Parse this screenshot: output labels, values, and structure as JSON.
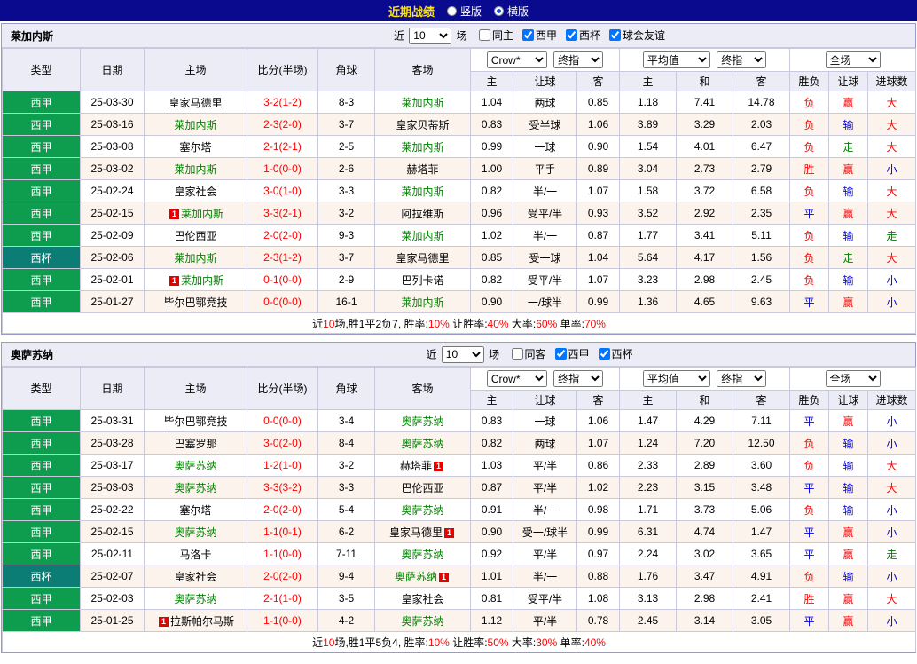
{
  "topbar": {
    "title": "近期战绩",
    "radio_vertical": "竖版",
    "radio_horizontal": "横版",
    "selected": "横版"
  },
  "columns": {
    "type": "类型",
    "date": "日期",
    "home": "主场",
    "score": "比分(半场)",
    "corner": "角球",
    "away": "客场",
    "odds_home": "主",
    "odds_handicap": "让球",
    "odds_away": "客",
    "avg_home": "主",
    "avg_draw": "和",
    "avg_away": "客",
    "result": "胜负",
    "handicap_result": "让球",
    "goals": "进球数"
  },
  "filters": {
    "near_label": "近",
    "count_value": "10",
    "match_label": "场",
    "dropdown_crow": "Crow*",
    "dropdown_final1": "终指",
    "dropdown_avg": "平均值",
    "dropdown_final2": "终指",
    "dropdown_fulltime": "全场"
  },
  "colors": {
    "topbar_bg": "#0a0a8f",
    "title_yellow": "#ffe400",
    "liga_green": "#0e9d4e",
    "cup_teal": "#0c7d74",
    "focus_team_green": "#008000",
    "score_red": "#ff0000",
    "win_red": "#ff0000",
    "lose_blue": "#0000e6",
    "push_green": "#008000",
    "header_lavender": "#ececf6",
    "alt_row_pink": "#fcf3ec"
  },
  "sections": [
    {
      "team": "莱加内斯",
      "checkboxes": [
        {
          "label": "同主",
          "checked": false
        },
        {
          "label": "西甲",
          "checked": true
        },
        {
          "label": "西杯",
          "checked": true
        },
        {
          "label": "球会友谊",
          "checked": true
        }
      ],
      "rows": [
        {
          "league": "西甲",
          "league_style": "liga",
          "date": "25-03-30",
          "home": {
            "name": "皇家马德里",
            "focus": false,
            "badge": ""
          },
          "score": "3-2(1-2)",
          "corners": "8-3",
          "away": {
            "name": "莱加内斯",
            "focus": true,
            "badge": ""
          },
          "odds": [
            "1.04",
            "两球",
            "0.85"
          ],
          "avg": [
            "1.18",
            "7.41",
            "14.78"
          ],
          "result": {
            "t": "负",
            "c": "r"
          },
          "handicap": {
            "t": "赢",
            "c": "r"
          },
          "goals": {
            "t": "大",
            "c": "r"
          }
        },
        {
          "league": "西甲",
          "league_style": "liga",
          "date": "25-03-16",
          "home": {
            "name": "莱加内斯",
            "focus": true,
            "badge": ""
          },
          "score": "2-3(2-0)",
          "corners": "3-7",
          "away": {
            "name": "皇家贝蒂斯",
            "focus": false,
            "badge": ""
          },
          "odds": [
            "0.83",
            "受半球",
            "1.06"
          ],
          "avg": [
            "3.89",
            "3.29",
            "2.03"
          ],
          "result": {
            "t": "负",
            "c": "r"
          },
          "handicap": {
            "t": "输",
            "c": "b"
          },
          "goals": {
            "t": "大",
            "c": "r"
          }
        },
        {
          "league": "西甲",
          "league_style": "liga",
          "date": "25-03-08",
          "home": {
            "name": "塞尔塔",
            "focus": false,
            "badge": ""
          },
          "score": "2-1(2-1)",
          "corners": "2-5",
          "away": {
            "name": "莱加内斯",
            "focus": true,
            "badge": ""
          },
          "odds": [
            "0.99",
            "一球",
            "0.90"
          ],
          "avg": [
            "1.54",
            "4.01",
            "6.47"
          ],
          "result": {
            "t": "负",
            "c": "r"
          },
          "handicap": {
            "t": "走",
            "c": "g"
          },
          "goals": {
            "t": "大",
            "c": "r"
          }
        },
        {
          "league": "西甲",
          "league_style": "liga",
          "date": "25-03-02",
          "home": {
            "name": "莱加内斯",
            "focus": true,
            "badge": ""
          },
          "score": "1-0(0-0)",
          "corners": "2-6",
          "away": {
            "name": "赫塔菲",
            "focus": false,
            "badge": ""
          },
          "odds": [
            "1.00",
            "平手",
            "0.89"
          ],
          "avg": [
            "3.04",
            "2.73",
            "2.79"
          ],
          "result": {
            "t": "胜",
            "c": "r"
          },
          "handicap": {
            "t": "赢",
            "c": "r"
          },
          "goals": {
            "t": "小",
            "c": "b"
          }
        },
        {
          "league": "西甲",
          "league_style": "liga",
          "date": "25-02-24",
          "home": {
            "name": "皇家社会",
            "focus": false,
            "badge": ""
          },
          "score": "3-0(1-0)",
          "corners": "3-3",
          "away": {
            "name": "莱加内斯",
            "focus": true,
            "badge": ""
          },
          "odds": [
            "0.82",
            "半/一",
            "1.07"
          ],
          "avg": [
            "1.58",
            "3.72",
            "6.58"
          ],
          "result": {
            "t": "负",
            "c": "r"
          },
          "handicap": {
            "t": "输",
            "c": "b"
          },
          "goals": {
            "t": "大",
            "c": "r"
          }
        },
        {
          "league": "西甲",
          "league_style": "liga",
          "date": "25-02-15",
          "home": {
            "name": "莱加内斯",
            "focus": true,
            "badge": "before"
          },
          "score": "3-3(2-1)",
          "corners": "3-2",
          "away": {
            "name": "阿拉维斯",
            "focus": false,
            "badge": ""
          },
          "odds": [
            "0.96",
            "受平/半",
            "0.93"
          ],
          "avg": [
            "3.52",
            "2.92",
            "2.35"
          ],
          "result": {
            "t": "平",
            "c": "b"
          },
          "handicap": {
            "t": "赢",
            "c": "r"
          },
          "goals": {
            "t": "大",
            "c": "r"
          }
        },
        {
          "league": "西甲",
          "league_style": "liga",
          "date": "25-02-09",
          "home": {
            "name": "巴伦西亚",
            "focus": false,
            "badge": ""
          },
          "score": "2-0(2-0)",
          "corners": "9-3",
          "away": {
            "name": "莱加内斯",
            "focus": true,
            "badge": ""
          },
          "odds": [
            "1.02",
            "半/一",
            "0.87"
          ],
          "avg": [
            "1.77",
            "3.41",
            "5.11"
          ],
          "result": {
            "t": "负",
            "c": "r"
          },
          "handicap": {
            "t": "输",
            "c": "b"
          },
          "goals": {
            "t": "走",
            "c": "g"
          }
        },
        {
          "league": "西杯",
          "league_style": "cup",
          "date": "25-02-06",
          "home": {
            "name": "莱加内斯",
            "focus": true,
            "badge": ""
          },
          "score": "2-3(1-2)",
          "corners": "3-7",
          "away": {
            "name": "皇家马德里",
            "focus": false,
            "badge": ""
          },
          "odds": [
            "0.85",
            "受一球",
            "1.04"
          ],
          "avg": [
            "5.64",
            "4.17",
            "1.56"
          ],
          "result": {
            "t": "负",
            "c": "r"
          },
          "handicap": {
            "t": "走",
            "c": "g"
          },
          "goals": {
            "t": "大",
            "c": "r"
          }
        },
        {
          "league": "西甲",
          "league_style": "liga",
          "date": "25-02-01",
          "home": {
            "name": "莱加内斯",
            "focus": true,
            "badge": "before"
          },
          "score": "0-1(0-0)",
          "corners": "2-9",
          "away": {
            "name": "巴列卡诺",
            "focus": false,
            "badge": ""
          },
          "odds": [
            "0.82",
            "受平/半",
            "1.07"
          ],
          "avg": [
            "3.23",
            "2.98",
            "2.45"
          ],
          "result": {
            "t": "负",
            "c": "r"
          },
          "handicap": {
            "t": "输",
            "c": "b"
          },
          "goals": {
            "t": "小",
            "c": "b"
          }
        },
        {
          "league": "西甲",
          "league_style": "liga",
          "date": "25-01-27",
          "home": {
            "name": "毕尔巴鄂竞技",
            "focus": false,
            "badge": ""
          },
          "score": "0-0(0-0)",
          "corners": "16-1",
          "away": {
            "name": "莱加内斯",
            "focus": true,
            "badge": ""
          },
          "odds": [
            "0.90",
            "一/球半",
            "0.99"
          ],
          "avg": [
            "1.36",
            "4.65",
            "9.63"
          ],
          "result": {
            "t": "平",
            "c": "b"
          },
          "handicap": {
            "t": "赢",
            "c": "r"
          },
          "goals": {
            "t": "小",
            "c": "b"
          }
        }
      ],
      "summary": [
        {
          "t": "近",
          "c": "k"
        },
        {
          "t": "10",
          "c": "r"
        },
        {
          "t": "场,胜1平2负7, 胜率:",
          "c": "k"
        },
        {
          "t": "10%",
          "c": "r"
        },
        {
          "t": " 让胜率:",
          "c": "k"
        },
        {
          "t": "40%",
          "c": "r"
        },
        {
          "t": " 大率:",
          "c": "k"
        },
        {
          "t": "60%",
          "c": "r"
        },
        {
          "t": " 单率:",
          "c": "k"
        },
        {
          "t": "70%",
          "c": "r"
        }
      ]
    },
    {
      "team": "奥萨苏纳",
      "checkboxes": [
        {
          "label": "同客",
          "checked": false
        },
        {
          "label": "西甲",
          "checked": true
        },
        {
          "label": "西杯",
          "checked": true
        }
      ],
      "rows": [
        {
          "league": "西甲",
          "league_style": "liga",
          "date": "25-03-31",
          "home": {
            "name": "毕尔巴鄂竞技",
            "focus": false,
            "badge": ""
          },
          "score": "0-0(0-0)",
          "corners": "3-4",
          "away": {
            "name": "奥萨苏纳",
            "focus": true,
            "badge": ""
          },
          "odds": [
            "0.83",
            "一球",
            "1.06"
          ],
          "avg": [
            "1.47",
            "4.29",
            "7.11"
          ],
          "result": {
            "t": "平",
            "c": "b"
          },
          "handicap": {
            "t": "赢",
            "c": "r"
          },
          "goals": {
            "t": "小",
            "c": "b"
          }
        },
        {
          "league": "西甲",
          "league_style": "liga",
          "date": "25-03-28",
          "home": {
            "name": "巴塞罗那",
            "focus": false,
            "badge": ""
          },
          "score": "3-0(2-0)",
          "corners": "8-4",
          "away": {
            "name": "奥萨苏纳",
            "focus": true,
            "badge": ""
          },
          "odds": [
            "0.82",
            "两球",
            "1.07"
          ],
          "avg": [
            "1.24",
            "7.20",
            "12.50"
          ],
          "result": {
            "t": "负",
            "c": "r"
          },
          "handicap": {
            "t": "输",
            "c": "b"
          },
          "goals": {
            "t": "小",
            "c": "b"
          }
        },
        {
          "league": "西甲",
          "league_style": "liga",
          "date": "25-03-17",
          "home": {
            "name": "奥萨苏纳",
            "focus": true,
            "badge": ""
          },
          "score": "1-2(1-0)",
          "corners": "3-2",
          "away": {
            "name": "赫塔菲",
            "focus": false,
            "badge": "after"
          },
          "odds": [
            "1.03",
            "平/半",
            "0.86"
          ],
          "avg": [
            "2.33",
            "2.89",
            "3.60"
          ],
          "result": {
            "t": "负",
            "c": "r"
          },
          "handicap": {
            "t": "输",
            "c": "b"
          },
          "goals": {
            "t": "大",
            "c": "r"
          }
        },
        {
          "league": "西甲",
          "league_style": "liga",
          "date": "25-03-03",
          "home": {
            "name": "奥萨苏纳",
            "focus": true,
            "badge": ""
          },
          "score": "3-3(3-2)",
          "corners": "3-3",
          "away": {
            "name": "巴伦西亚",
            "focus": false,
            "badge": ""
          },
          "odds": [
            "0.87",
            "平/半",
            "1.02"
          ],
          "avg": [
            "2.23",
            "3.15",
            "3.48"
          ],
          "result": {
            "t": "平",
            "c": "b"
          },
          "handicap": {
            "t": "输",
            "c": "b"
          },
          "goals": {
            "t": "大",
            "c": "r"
          }
        },
        {
          "league": "西甲",
          "league_style": "liga",
          "date": "25-02-22",
          "home": {
            "name": "塞尔塔",
            "focus": false,
            "badge": ""
          },
          "score": "2-0(2-0)",
          "corners": "5-4",
          "away": {
            "name": "奥萨苏纳",
            "focus": true,
            "badge": ""
          },
          "odds": [
            "0.91",
            "半/一",
            "0.98"
          ],
          "avg": [
            "1.71",
            "3.73",
            "5.06"
          ],
          "result": {
            "t": "负",
            "c": "r"
          },
          "handicap": {
            "t": "输",
            "c": "b"
          },
          "goals": {
            "t": "小",
            "c": "b"
          }
        },
        {
          "league": "西甲",
          "league_style": "liga",
          "date": "25-02-15",
          "home": {
            "name": "奥萨苏纳",
            "focus": true,
            "badge": ""
          },
          "score": "1-1(0-1)",
          "corners": "6-2",
          "away": {
            "name": "皇家马德里",
            "focus": false,
            "badge": "after"
          },
          "odds": [
            "0.90",
            "受一/球半",
            "0.99"
          ],
          "avg": [
            "6.31",
            "4.74",
            "1.47"
          ],
          "result": {
            "t": "平",
            "c": "b"
          },
          "handicap": {
            "t": "赢",
            "c": "r"
          },
          "goals": {
            "t": "小",
            "c": "b"
          }
        },
        {
          "league": "西甲",
          "league_style": "liga",
          "date": "25-02-11",
          "home": {
            "name": "马洛卡",
            "focus": false,
            "badge": ""
          },
          "score": "1-1(0-0)",
          "corners": "7-11",
          "away": {
            "name": "奥萨苏纳",
            "focus": true,
            "badge": ""
          },
          "odds": [
            "0.92",
            "平/半",
            "0.97"
          ],
          "avg": [
            "2.24",
            "3.02",
            "3.65"
          ],
          "result": {
            "t": "平",
            "c": "b"
          },
          "handicap": {
            "t": "赢",
            "c": "r"
          },
          "goals": {
            "t": "走",
            "c": "g"
          }
        },
        {
          "league": "西杯",
          "league_style": "cup",
          "date": "25-02-07",
          "home": {
            "name": "皇家社会",
            "focus": false,
            "badge": ""
          },
          "score": "2-0(2-0)",
          "corners": "9-4",
          "away": {
            "name": "奥萨苏纳",
            "focus": true,
            "badge": "after"
          },
          "odds": [
            "1.01",
            "半/一",
            "0.88"
          ],
          "avg": [
            "1.76",
            "3.47",
            "4.91"
          ],
          "result": {
            "t": "负",
            "c": "r"
          },
          "handicap": {
            "t": "输",
            "c": "b"
          },
          "goals": {
            "t": "小",
            "c": "b"
          }
        },
        {
          "league": "西甲",
          "league_style": "liga",
          "date": "25-02-03",
          "home": {
            "name": "奥萨苏纳",
            "focus": true,
            "badge": ""
          },
          "score": "2-1(1-0)",
          "corners": "3-5",
          "away": {
            "name": "皇家社会",
            "focus": false,
            "badge": ""
          },
          "odds": [
            "0.81",
            "受平/半",
            "1.08"
          ],
          "avg": [
            "3.13",
            "2.98",
            "2.41"
          ],
          "result": {
            "t": "胜",
            "c": "r"
          },
          "handicap": {
            "t": "赢",
            "c": "r"
          },
          "goals": {
            "t": "大",
            "c": "r"
          }
        },
        {
          "league": "西甲",
          "league_style": "liga",
          "date": "25-01-25",
          "home": {
            "name": "拉斯帕尔马斯",
            "focus": false,
            "badge": "before"
          },
          "score": "1-1(0-0)",
          "corners": "4-2",
          "away": {
            "name": "奥萨苏纳",
            "focus": true,
            "badge": ""
          },
          "odds": [
            "1.12",
            "平/半",
            "0.78"
          ],
          "avg": [
            "2.45",
            "3.14",
            "3.05"
          ],
          "result": {
            "t": "平",
            "c": "b"
          },
          "handicap": {
            "t": "赢",
            "c": "r"
          },
          "goals": {
            "t": "小",
            "c": "b"
          }
        }
      ],
      "summary": [
        {
          "t": "近",
          "c": "k"
        },
        {
          "t": "10",
          "c": "r"
        },
        {
          "t": "场,胜1平5负4, 胜率:",
          "c": "k"
        },
        {
          "t": "10%",
          "c": "r"
        },
        {
          "t": " 让胜率:",
          "c": "k"
        },
        {
          "t": "50%",
          "c": "r"
        },
        {
          "t": " 大率:",
          "c": "k"
        },
        {
          "t": "30%",
          "c": "r"
        },
        {
          "t": " 单率:",
          "c": "k"
        },
        {
          "t": "40%",
          "c": "r"
        }
      ]
    }
  ]
}
